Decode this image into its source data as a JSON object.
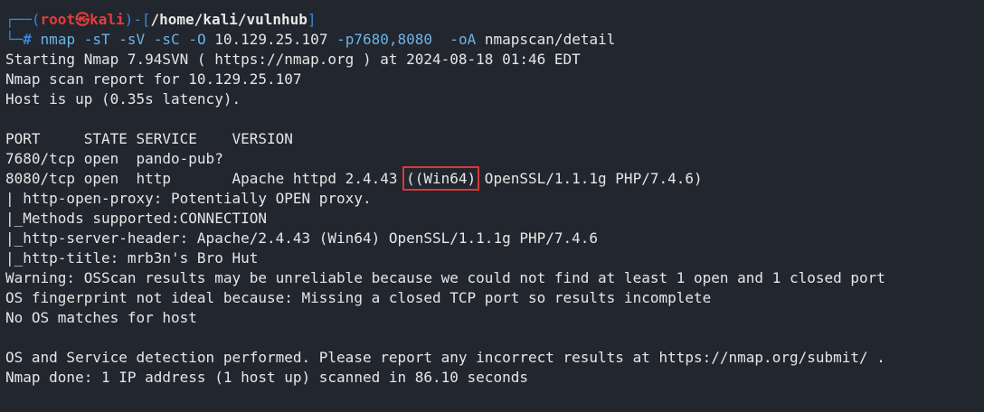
{
  "prompt": {
    "frame_top": "┌──(",
    "user": "root",
    "at_symbol": "㉿",
    "host": "kali",
    "frame_mid": ")-[",
    "cwd": "/home/kali/vulnhub",
    "frame_end": "]",
    "frame_bottom": "└─",
    "hash": "#",
    "command_name": "nmap",
    "command_flags": "-sT -sV -sC -O",
    "command_target": "10.129.25.107",
    "command_ports": "-p7680,8080",
    "command_output_flag": "-oA",
    "command_output_path": "nmapscan/detail"
  },
  "output": {
    "start": "Starting Nmap 7.94SVN ( https://nmap.org ) at 2024-08-18 01:46 EDT",
    "report": "Nmap scan report for 10.129.25.107",
    "host_up": "Host is up (0.35s latency).",
    "header": "PORT     STATE SERVICE    VERSION",
    "row1": "7680/tcp open  pando-pub?",
    "row2_pre": "8080/tcp open  http       Apache httpd 2.4.43 ",
    "row2_highlight": "((Win64)",
    "row2_post": " OpenSSL/1.1.1g PHP/7.4.6)",
    "script1": "| http-open-proxy: Potentially OPEN proxy.",
    "script2": "|_Methods supported:CONNECTION",
    "script3": "|_http-server-header: Apache/2.4.43 (Win64) OpenSSL/1.1.1g PHP/7.4.6",
    "script4": "|_http-title: mrb3n's Bro Hut",
    "warning": "Warning: OSScan results may be unreliable because we could not find at least 1 open and 1 closed port",
    "fingerprint": "OS fingerprint not ideal because: Missing a closed TCP port so results incomplete",
    "no_match": "No OS matches for host",
    "detection": "OS and Service detection performed. Please report any incorrect results at https://nmap.org/submit/ .",
    "done": "Nmap done: 1 IP address (1 host up) scanned in 86.10 seconds"
  },
  "colors": {
    "background": "#22262e",
    "text": "#e6e6e6",
    "prompt_frame": "#3a86d8",
    "prompt_user": "#e63b3b",
    "highlight_box": "#d9383a"
  }
}
